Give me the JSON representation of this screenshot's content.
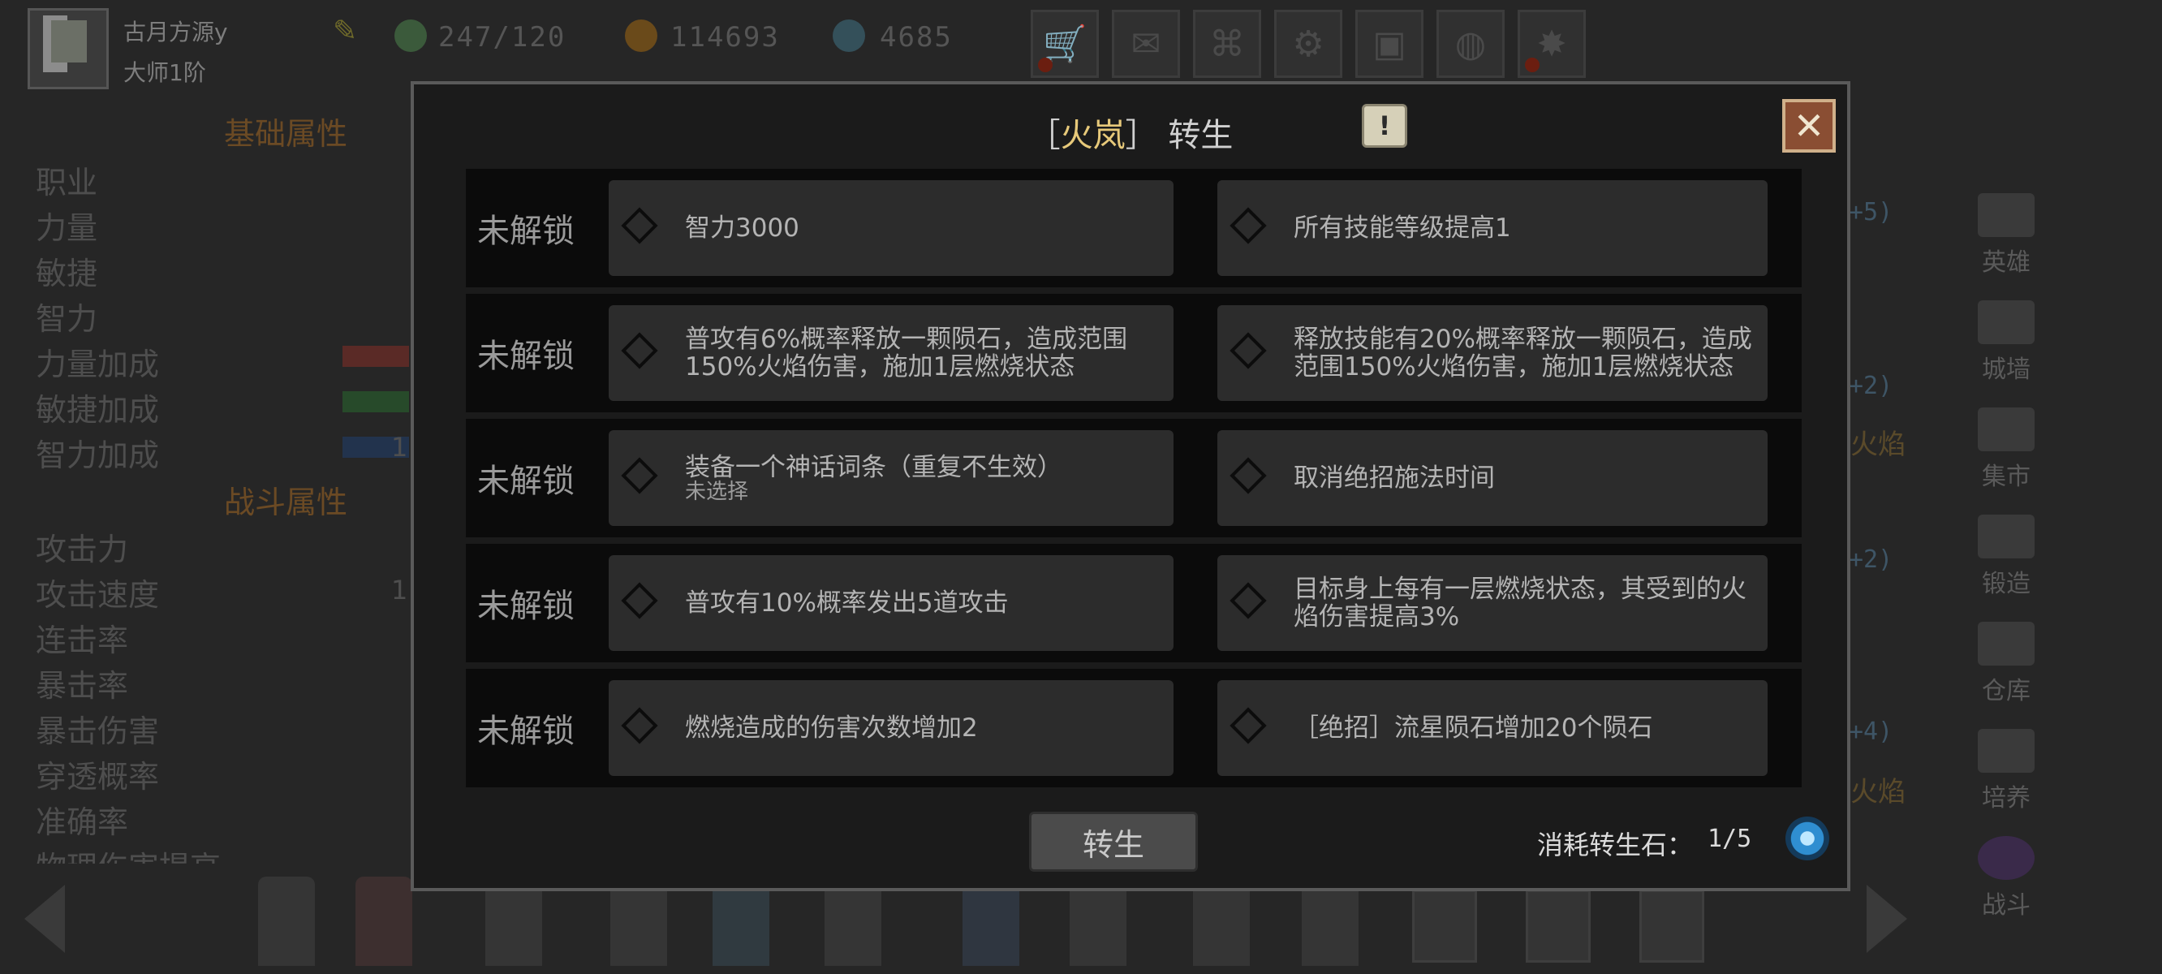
{
  "player": {
    "name": "古月方源y",
    "rank": "大师1阶"
  },
  "resources": {
    "energy": "247/120",
    "gold": "114693",
    "gems": "4685"
  },
  "top_buttons": [
    {
      "icon": "shop-cart-icon",
      "alert": true
    },
    {
      "icon": "mail-icon",
      "alert": false
    },
    {
      "icon": "gamepad-icon",
      "alert": false
    },
    {
      "icon": "gear-icon",
      "alert": false
    },
    {
      "icon": "gift-icon",
      "alert": false
    },
    {
      "icon": "color-wheel-icon",
      "alert": false
    },
    {
      "icon": "fireworks-icon",
      "alert": true
    }
  ],
  "left_panel": {
    "basic_title": "基础属性",
    "basic_stats": [
      "职业",
      "力量",
      "敏捷",
      "智力",
      "力量加成",
      "敏捷加成",
      "智力加成"
    ],
    "combat_title": "战斗属性",
    "combat_stats": [
      "攻击力",
      "攻击速度",
      "连击率",
      "暴击率",
      "暴击伤害",
      "穿透概率",
      "准确率",
      "物理伤害提高"
    ],
    "ghost_values": [
      "1",
      "1"
    ]
  },
  "right_nav": [
    "英雄",
    "城墙",
    "集市",
    "锻造",
    "仓库",
    "培养",
    "战斗"
  ],
  "ghost_right": {
    "values": [
      "+5)",
      "+2)",
      "+2)",
      "+4)"
    ],
    "words": [
      "火焰",
      "火焰"
    ]
  },
  "dialog": {
    "title_open": "［",
    "hero": "火岚",
    "title_close": "］",
    "title_text": "转生",
    "info_label": "!",
    "rows": [
      {
        "lock": "未解锁",
        "left": "智力3000",
        "left_sub": "",
        "right": "所有技能等级提高1"
      },
      {
        "lock": "未解锁",
        "left": "普攻有6%概率释放一颗陨石，造成范围150%火焰伤害，施加1层燃烧状态",
        "left_sub": "",
        "right": "释放技能有20%概率释放一颗陨石，造成范围150%火焰伤害，施加1层燃烧状态"
      },
      {
        "lock": "未解锁",
        "left": "装备一个神话词条（重复不生效）",
        "left_sub": "未选择",
        "right": "取消绝招施法时间"
      },
      {
        "lock": "未解锁",
        "left": "普攻有10%概率发出5道攻击",
        "left_sub": "",
        "right": "目标身上每有一层燃烧状态，其受到的火焰伤害提高3%"
      },
      {
        "lock": "未解锁",
        "left": "燃烧造成的伤害次数增加2",
        "left_sub": "",
        "right": "［绝招］流星陨石增加20个陨石"
      }
    ],
    "button": "转生",
    "cost_label": "消耗转生石：",
    "cost_value": "1/5"
  },
  "colors": {
    "accent": "#e7c97a",
    "close": "#8a4e33",
    "panel": "#1b1b1b"
  }
}
